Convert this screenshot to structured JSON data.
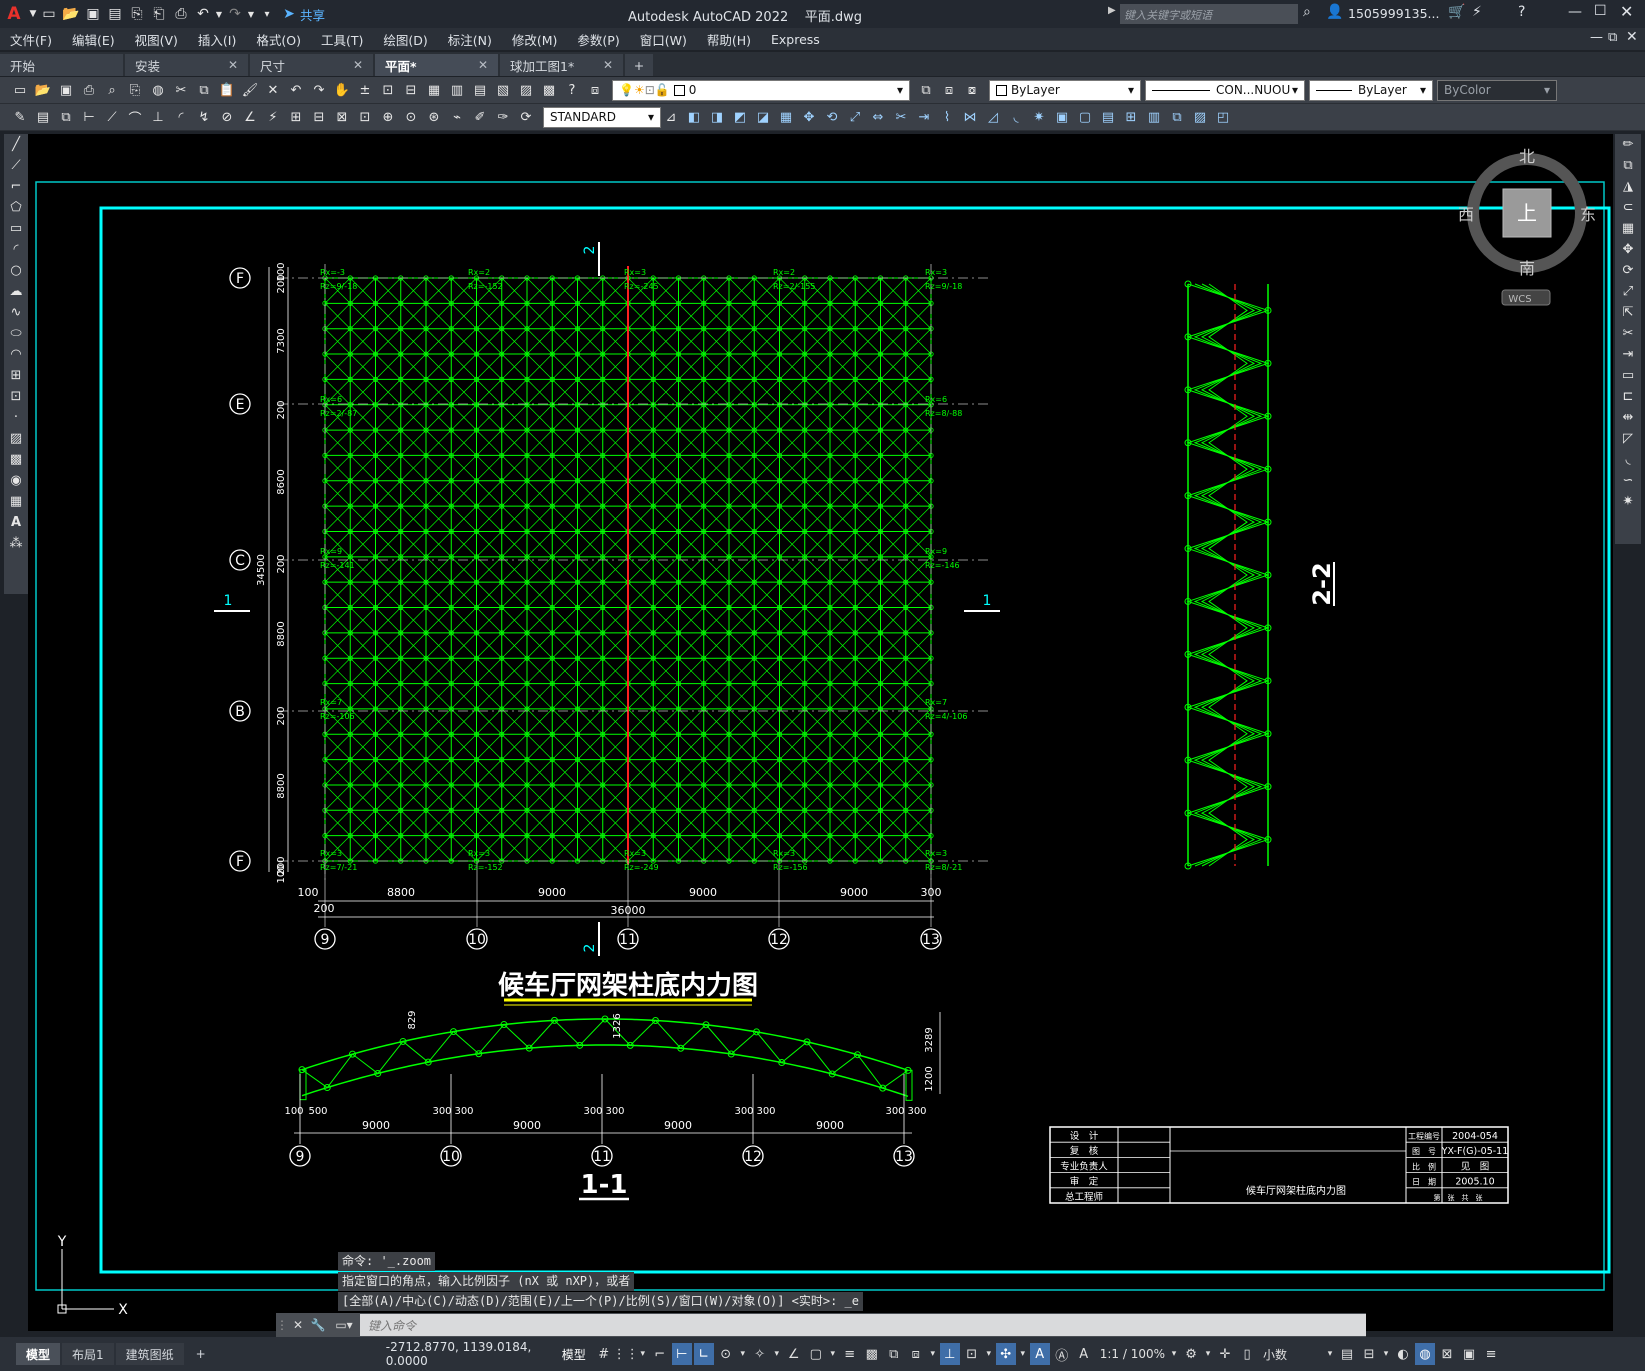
{
  "titlebar": {
    "app_title": "Autodesk AutoCAD 2022",
    "file_name": "平面.dwg",
    "share_label": "共享",
    "search_placeholder": "键入关键字或短语",
    "user_name": "1505999135...",
    "logo": "A"
  },
  "menu": [
    "文件(F)",
    "编辑(E)",
    "视图(V)",
    "插入(I)",
    "格式(O)",
    "工具(T)",
    "绘图(D)",
    "标注(N)",
    "修改(M)",
    "参数(P)",
    "窗口(W)",
    "帮助(H)",
    "Express"
  ],
  "tabs": [
    {
      "label": "开始",
      "active": false
    },
    {
      "label": "安装",
      "active": false
    },
    {
      "label": "尺寸",
      "active": false
    },
    {
      "label": "平面*",
      "active": true
    },
    {
      "label": "球加工图1*",
      "active": false
    }
  ],
  "toolbar": {
    "layer_value": "0",
    "color_value": "ByLayer",
    "linetype_value": "CON...NUOU",
    "lineweight_value": "ByLayer",
    "plotstyle_value": "ByColor",
    "textstyle_value": "STANDARD"
  },
  "viewcube": {
    "north": "北",
    "south": "南",
    "east": "东",
    "west": "西",
    "top": "上",
    "wcs": "WCS"
  },
  "drawing": {
    "plan_title": "候车厅网架柱底内力图",
    "section_11": "1-1",
    "section_22": "2-2",
    "cut_label_1": "1",
    "cut_label_2": "2",
    "axes_left": [
      "F",
      "E",
      "C",
      "B",
      "F"
    ],
    "axes_bottom": [
      "9",
      "10",
      "11",
      "12",
      "13"
    ],
    "dims_left": [
      "100",
      "200",
      "7300",
      "200",
      "8600",
      "200",
      "8800",
      "200",
      "8800",
      "200",
      "100"
    ],
    "dim_left_total": "34500",
    "dims_bottom": [
      "100",
      "8800",
      "9000",
      "9000",
      "9000",
      "300"
    ],
    "dim_bottom_200": "200",
    "dim_bottom_total": "36000",
    "section_dims": [
      "9000",
      "9000",
      "9000",
      "9000"
    ],
    "section_sub": [
      "100",
      "500",
      "300",
      "300",
      "300",
      "300",
      "300",
      "300",
      "300",
      "300"
    ],
    "section_heights": [
      "829",
      "3289",
      "1200",
      "1326"
    ],
    "reactions_top": [
      {
        "rx": "Rx=-3",
        "rz": "Rz=9/-18"
      },
      {
        "rx": "Rx=2",
        "rz": "Rz=-152"
      },
      {
        "rx": "Rx=3",
        "rz": "Rz=-245"
      },
      {
        "rx": "Rx=2",
        "rz": "Rz=2/-155"
      },
      {
        "rx": "Rx=3",
        "rz": "Rz=9/-18"
      }
    ],
    "reactions_bottom": [
      {
        "rx": "Rx=3",
        "rz": "Rz=7/-21"
      },
      {
        "rx": "Rx=3",
        "rz": "Rz=-152"
      },
      {
        "rx": "Rx=3",
        "rz": "Rz=-249"
      },
      {
        "rx": "Rx=3",
        "rz": "Rz=-156"
      },
      {
        "rx": "Rx=3",
        "rz": "Rz=8/-21"
      }
    ],
    "reactions_left": [
      {
        "rx": "Rx=6",
        "rz": "Rz=2/-87"
      },
      {
        "rx": "Rx=9",
        "rz": "Rz=-141"
      },
      {
        "rx": "Rx=7",
        "rz": "Rz=-106"
      }
    ],
    "reactions_right": [
      {
        "rx": "Rx=6",
        "rz": "Rz=8/-88"
      },
      {
        "rx": "Rx=9",
        "rz": "Rz=-146"
      },
      {
        "rx": "Rx=7",
        "rz": "Rz=4/-106"
      }
    ],
    "titleblock": {
      "roles": [
        "设　计",
        "复　核",
        "专业负责人",
        "审　定",
        "总工程师"
      ],
      "project_no_label": "工程编号",
      "project_no": "2004-054",
      "drawing_no_label": "图　号",
      "drawing_no": "YX-F(G)-05-11",
      "scale_label": "比　例",
      "scale": "见　图",
      "date_label": "日　期",
      "date": "2005.10",
      "sheet_labels": "第　张　共　张",
      "drawing_name": "候车厅网架柱底内力图"
    }
  },
  "command": {
    "history": [
      "命令: '_.zoom",
      "指定窗口的角点，输入比例因子 (nX 或 nXP)，或者",
      "[全部(A)/中心(C)/动态(D)/范围(E)/上一个(P)/比例(S)/窗口(W)/对象(O)] <实时>: _e"
    ],
    "placeholder": "键入命令"
  },
  "status": {
    "layout_tabs": [
      "模型",
      "布局1",
      "建筑图纸"
    ],
    "coords": "-2712.8770, 1139.0184, 0.0000",
    "mode": "模型",
    "scale": "1:1 / 100%",
    "units": "小数"
  },
  "colors": {
    "grid": "#00ff00",
    "frame": "#00ffff",
    "highlight": "#ff2020",
    "title_underline": "#ffff00",
    "canvas": "#000000"
  }
}
